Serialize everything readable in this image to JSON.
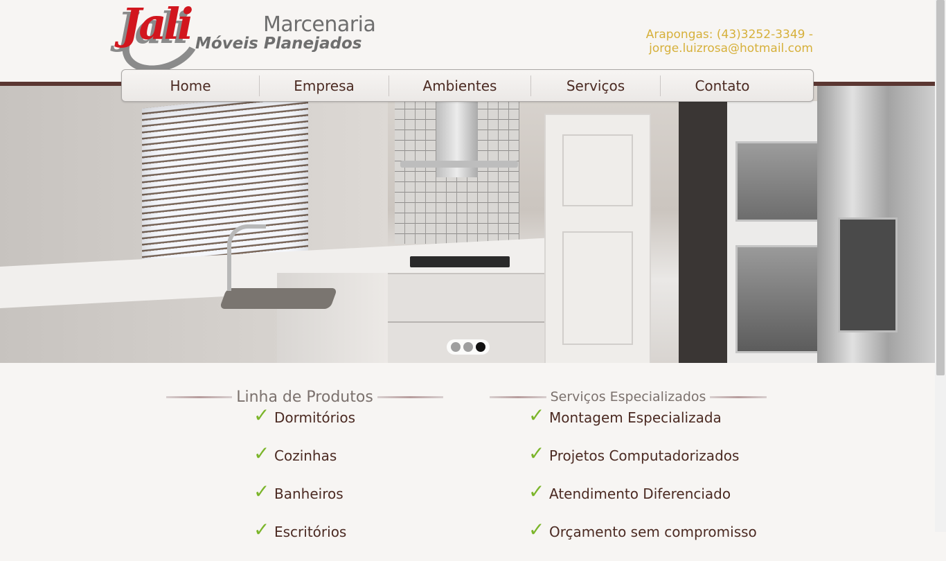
{
  "header": {
    "logo": {
      "brand": "Jali",
      "line1": "Marcenaria",
      "line2": "Móveis Planejados"
    },
    "contact": "Arapongas: (43)3252-3349 - jorge.luizrosa@hotmail.com"
  },
  "nav": {
    "items": [
      {
        "label": "Home"
      },
      {
        "label": "Empresa"
      },
      {
        "label": "Ambientes"
      },
      {
        "label": "Serviços"
      },
      {
        "label": "Contato"
      }
    ]
  },
  "slider": {
    "total": 3,
    "active_index": 3
  },
  "products": {
    "title": "Linha de Produtos",
    "items": [
      "Dormitórios",
      "Cozinhas",
      "Banheiros",
      "Escritórios"
    ]
  },
  "services": {
    "title": "Serviços Especializados",
    "items": [
      "Montagem Especializada",
      "Projetos Computadorizados",
      "Atendimento Diferenciado",
      "Orçamento sem compromisso"
    ]
  },
  "colors": {
    "accent_gold": "#d6b03a",
    "brand_red": "#d2161e",
    "nav_text": "#4b2a22",
    "check_green": "#7bb52a",
    "bar_brown": "#5b3732"
  }
}
